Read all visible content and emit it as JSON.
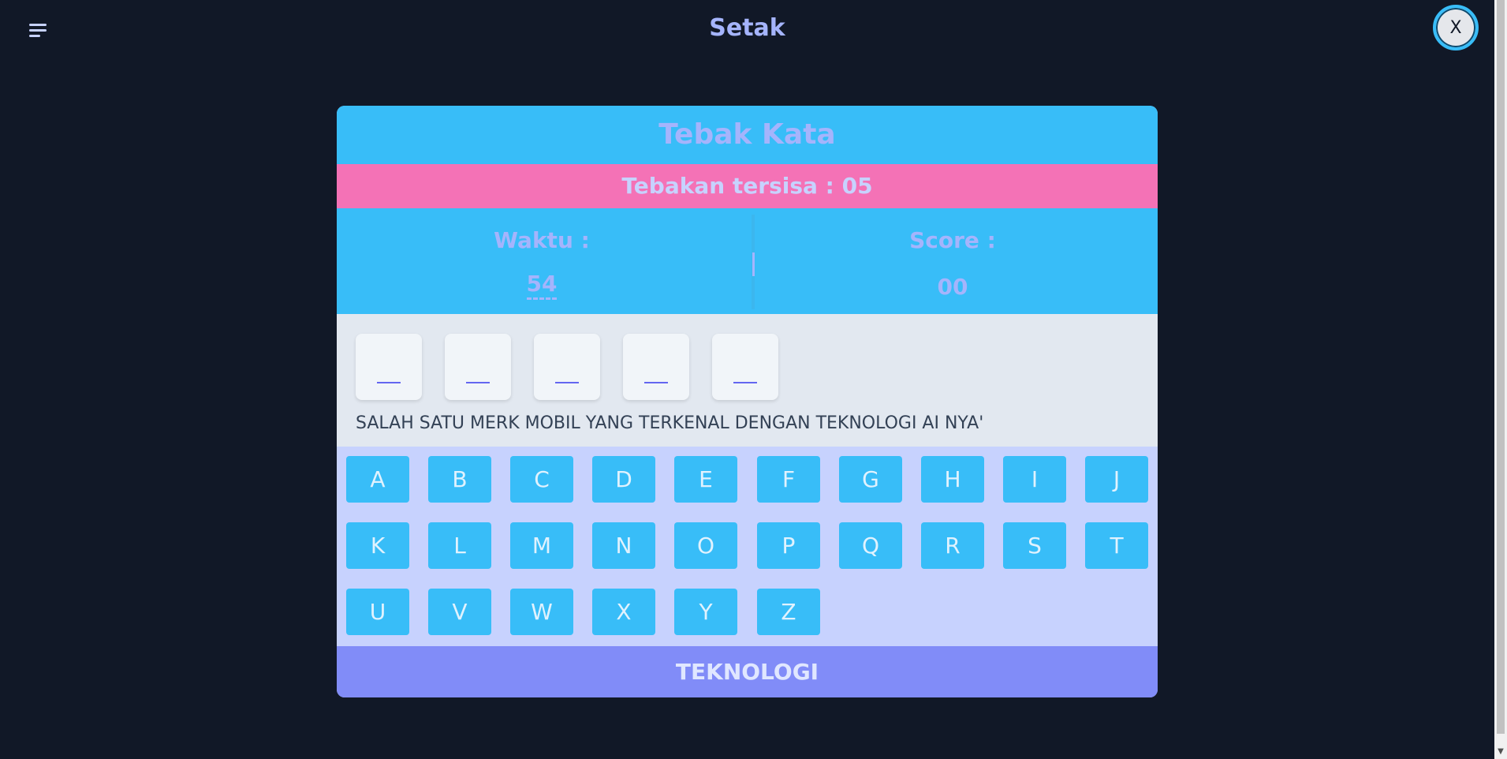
{
  "app": {
    "title": "Setak",
    "close_label": "X"
  },
  "game": {
    "title": "Tebak Kata",
    "guesses_remaining": "Tebakan tersisa : 05",
    "time_label": "Waktu :",
    "time_value": "54",
    "score_label": "Score :",
    "score_value": "00",
    "slots": [
      "__",
      "__",
      "__",
      "__",
      "__"
    ],
    "hint": "SALAH SATU MERK MOBIL YANG TERKENAL DENGAN TEKNOLOGI AI NYA'",
    "keyboard_rows": [
      [
        "A",
        "B",
        "C",
        "D",
        "E",
        "F",
        "G",
        "H",
        "I",
        "J"
      ],
      [
        "K",
        "L",
        "M",
        "N",
        "O",
        "P",
        "Q",
        "R",
        "S",
        "T"
      ],
      [
        "U",
        "V",
        "W",
        "X",
        "Y",
        "Z"
      ]
    ],
    "category": "TEKNOLOGI"
  },
  "colors": {
    "background": "#111827",
    "sky": "#38bdf8",
    "pink": "#f472b6",
    "indigo": "#818cf8",
    "lavender": "#c7d2fe"
  },
  "icons": {
    "menu": "menu-icon"
  }
}
